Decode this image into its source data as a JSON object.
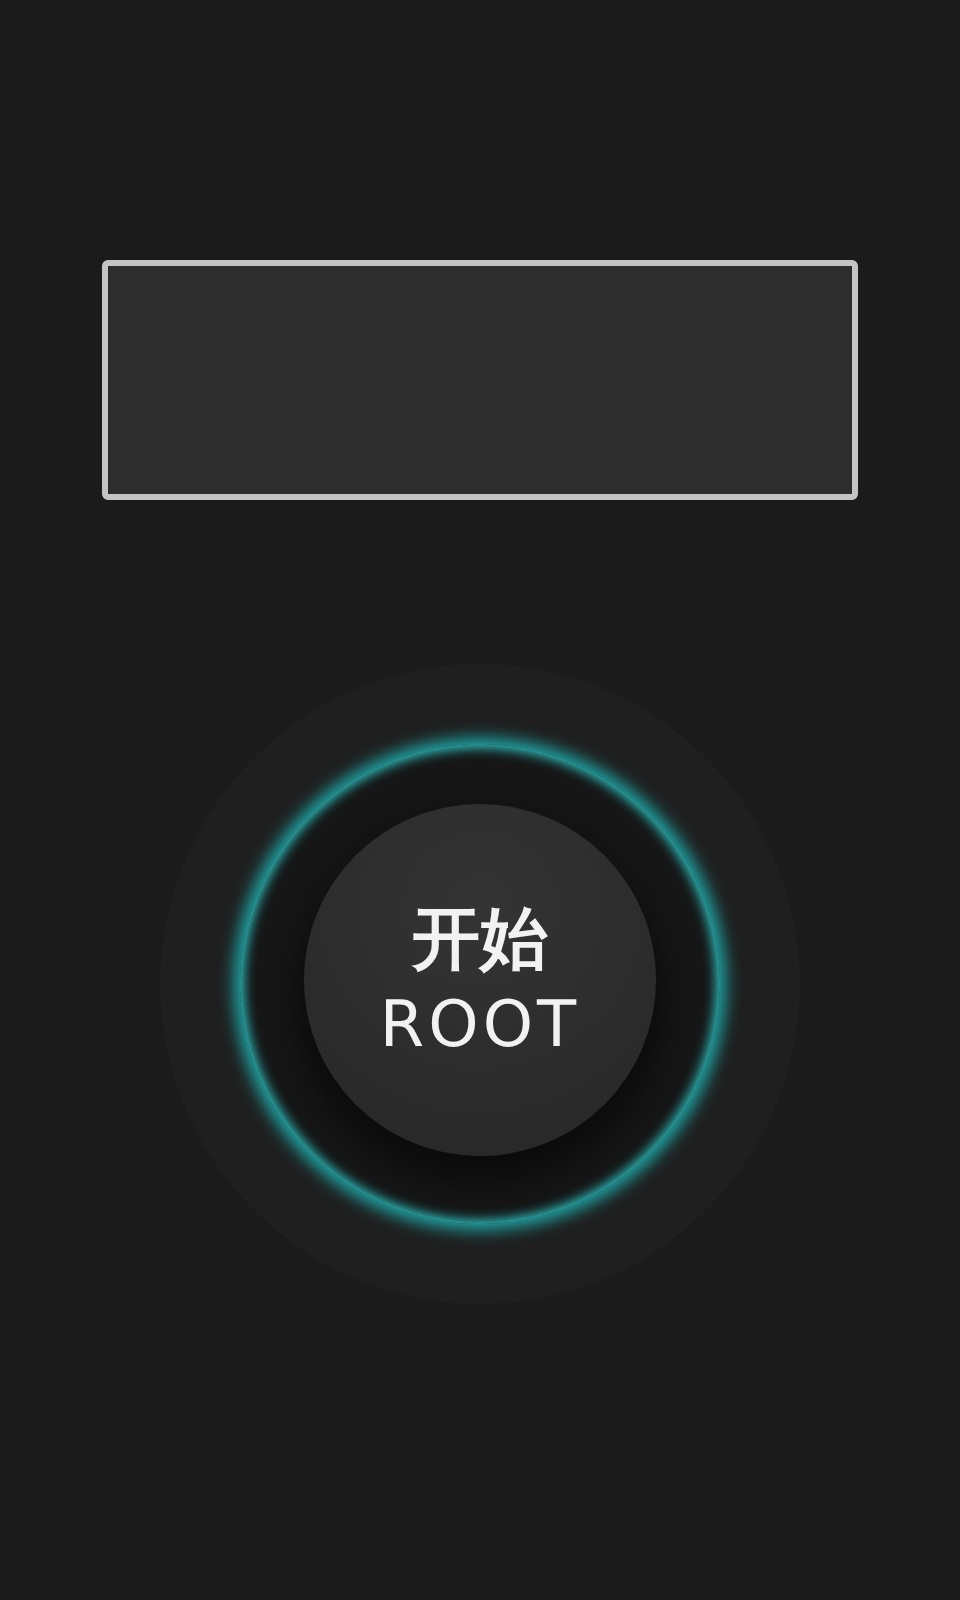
{
  "start_button": {
    "label_top": "开始",
    "label_bottom": "ROOT"
  }
}
